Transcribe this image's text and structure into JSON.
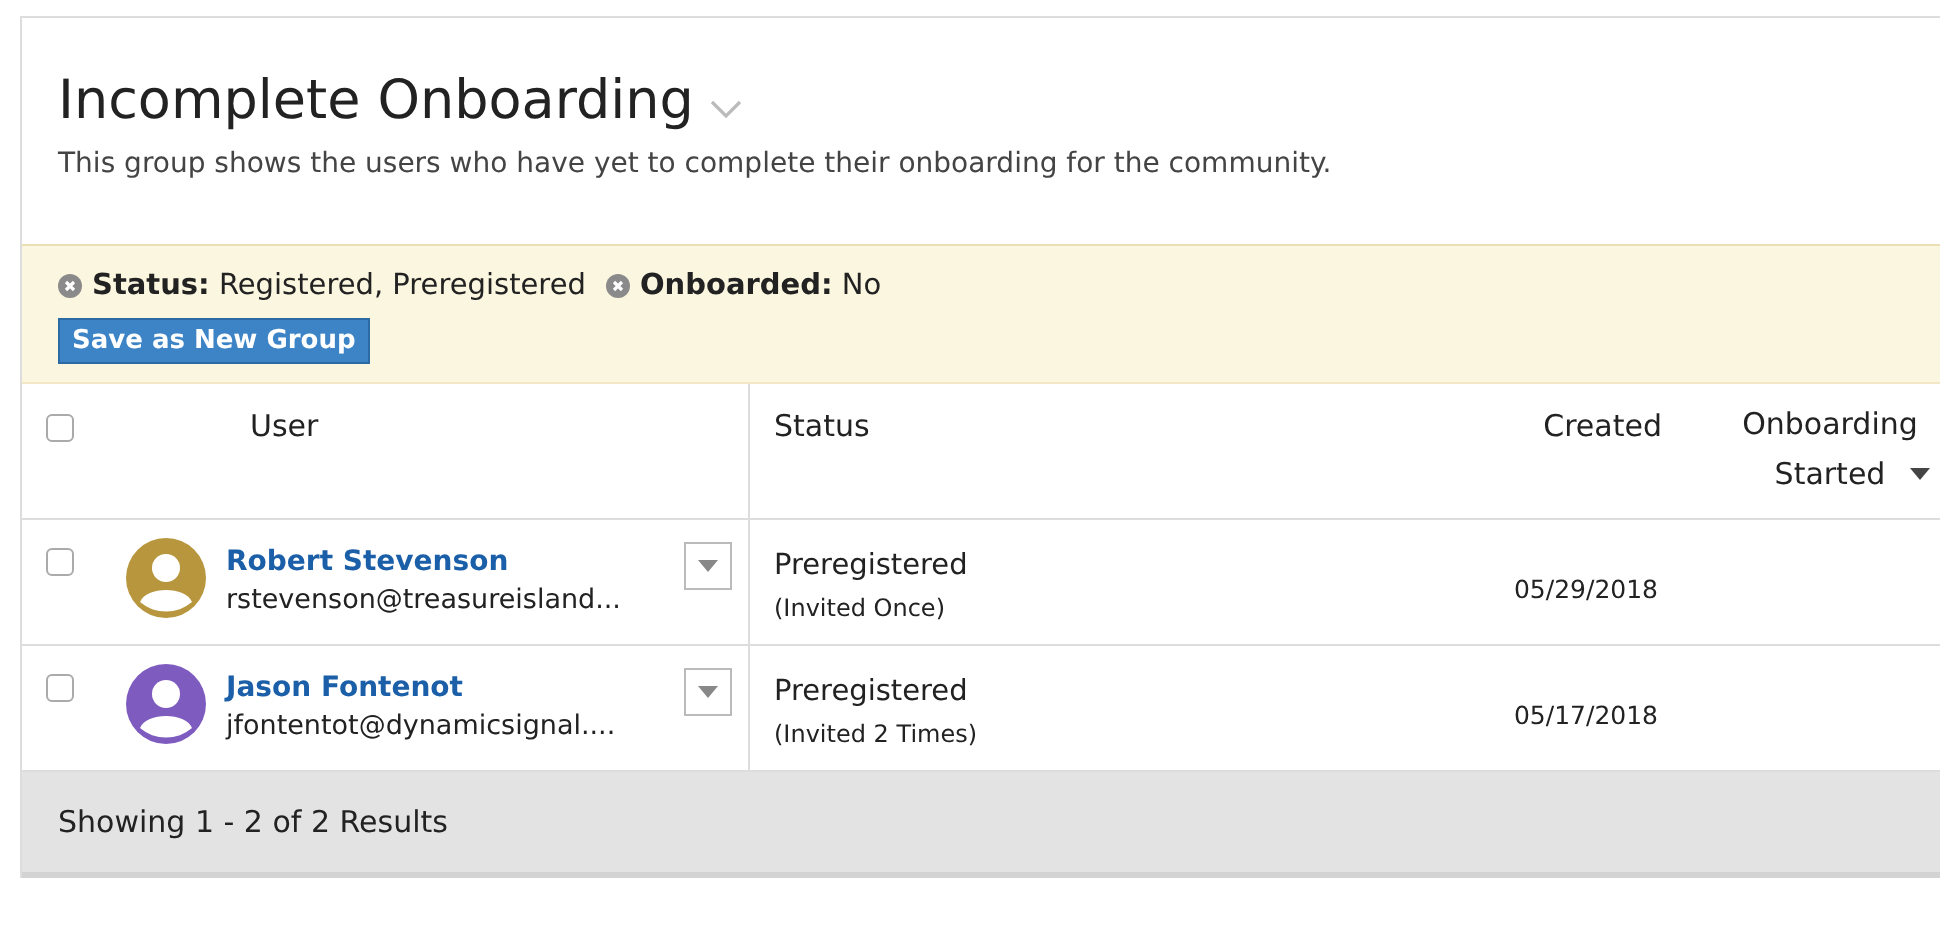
{
  "header": {
    "title": "Incomplete Onboarding",
    "description": "This group shows the users who have yet to complete their onboarding for the community."
  },
  "filters": [
    {
      "label": "Status:",
      "value": "Registered, Preregistered"
    },
    {
      "label": "Onboarded:",
      "value": "No"
    }
  ],
  "save_button": "Save as New Group",
  "table": {
    "select_all": {
      "checked": false
    },
    "columns": [
      {
        "label": "User"
      },
      {
        "label": "Status"
      },
      {
        "label": "Created"
      },
      {
        "label": "Onboarding Started",
        "sorted": true
      }
    ],
    "rows": [
      {
        "checked": false,
        "color": "#b8963e",
        "name": "Robert Stevenson",
        "email": "rstevenson@treasureisland...",
        "status": "Preregistered",
        "invites": "(Invited Once)",
        "created": "05/29/2018"
      },
      {
        "checked": false,
        "color": "#7e5bbf",
        "name": "Jason Fontenot",
        "email": "jfontentot@dynamicsignal....",
        "status": "Preregistered",
        "invites": "(Invited 2 Times)",
        "created": "05/17/2018"
      }
    ]
  },
  "footer": "Showing 1 - 2 of 2 Results"
}
